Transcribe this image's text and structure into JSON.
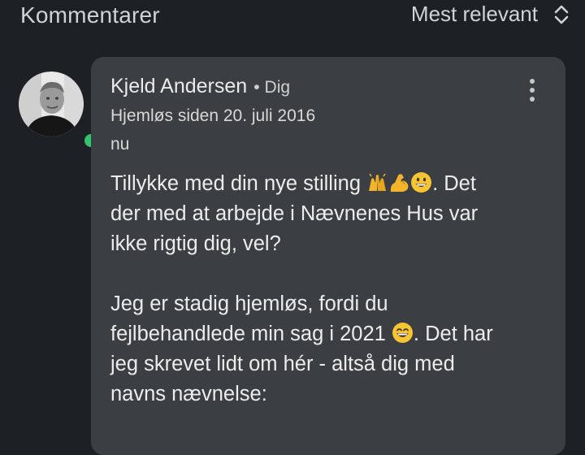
{
  "header": {
    "title": "Kommentarer",
    "sort_label": "Mest relevant"
  },
  "icons": {
    "sort": "sort-updown-icon",
    "more": "more-vertical-icon",
    "emoji1": "raising-hands-emoji",
    "emoji2": "flexed-biceps-emoji",
    "emoji3": "grinning-face-emoji",
    "emoji4": "grinning-smiling-eyes-emoji"
  },
  "colors": {
    "background": "#1d2125",
    "bubble": "#3b3f43",
    "online": "#32c36c"
  },
  "comment": {
    "author": "Kjeld Andersen",
    "separator": "•",
    "relation": "Dig",
    "subtitle": "Hjemløs siden 20. juli 2016",
    "timestamp": "nu",
    "p1_l1_a": "Tillykke med din nye stilling ",
    "p1_l1_b": ".  Det",
    "p1_l2": "der med at arbejde i Nævnenes Hus var",
    "p1_l3": "ikke rigtig dig, vel?",
    "p2_l1": "Jeg er stadig hjemløs, fordi du",
    "p2_l2_a": "fejlbehandlede min sag i 2021 ",
    "p2_l2_b": ". Det har",
    "p2_l3": "jeg skrevet lidt om hér - altså dig med",
    "p2_l4": "navns nævnelse:"
  }
}
